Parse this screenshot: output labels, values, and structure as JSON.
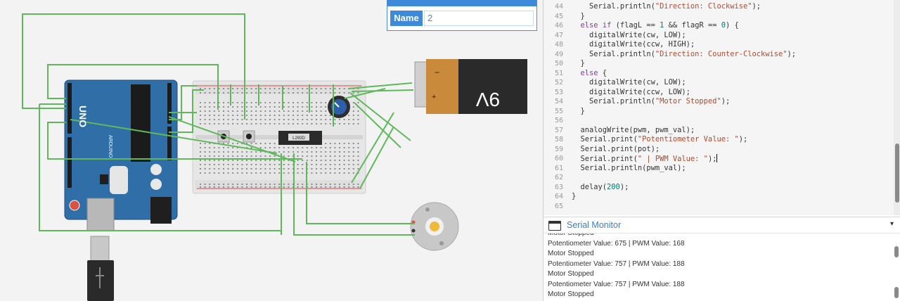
{
  "inspector": {
    "name_label": "Name",
    "name_value": "2"
  },
  "circuit": {
    "arduino_brand": "UNO",
    "arduino_sub": "ARDUINO",
    "ic_label": "L293D",
    "battery_label": "9V",
    "battery_minus": "−",
    "battery_plus": "+"
  },
  "editor": {
    "lines": [
      {
        "n": "44",
        "t": "    Serial.println(\"Direction: Clockwise\");"
      },
      {
        "n": "45",
        "t": "  }"
      },
      {
        "n": "46",
        "t": "  else if (flagL == 1 && flagR == 0) {"
      },
      {
        "n": "47",
        "t": "    digitalWrite(cw, LOW);"
      },
      {
        "n": "48",
        "t": "    digitalWrite(ccw, HIGH);"
      },
      {
        "n": "49",
        "t": "    Serial.println(\"Direction: Counter-Clockwise\");"
      },
      {
        "n": "50",
        "t": "  }"
      },
      {
        "n": "51",
        "t": "  else {"
      },
      {
        "n": "52",
        "t": "    digitalWrite(cw, LOW);"
      },
      {
        "n": "53",
        "t": "    digitalWrite(ccw, LOW);"
      },
      {
        "n": "54",
        "t": "    Serial.println(\"Motor Stopped\");"
      },
      {
        "n": "55",
        "t": "  }"
      },
      {
        "n": "56",
        "t": ""
      },
      {
        "n": "57",
        "t": "  analogWrite(pwm, pwm_val);"
      },
      {
        "n": "58",
        "t": "  Serial.print(\"Potentiometer Value: \");"
      },
      {
        "n": "59",
        "t": "  Serial.print(pot);"
      },
      {
        "n": "60",
        "t": "  Serial.print(\" | PWM Value: \");"
      },
      {
        "n": "61",
        "t": "  Serial.println(pwm_val);"
      },
      {
        "n": "62",
        "t": ""
      },
      {
        "n": "63",
        "t": "  delay(200);"
      },
      {
        "n": "64",
        "t": "}"
      },
      {
        "n": "65",
        "t": ""
      }
    ]
  },
  "serial": {
    "title": "Serial Monitor",
    "collapse_icon": "▾",
    "lines": [
      "Motor Stopped",
      "Potentiometer Value: 675 | PWM Value: 168",
      "Motor Stopped",
      "Potentiometer Value: 757 | PWM Value: 188",
      "Motor Stopped",
      "Potentiometer Value: 757 | PWM Value: 188",
      "Motor Stopped"
    ]
  },
  "colors": {
    "accent": "#3f8ad8",
    "wire": "#5fb85a",
    "arduino": "#2f6ea6",
    "battery": "#c98a3c"
  }
}
